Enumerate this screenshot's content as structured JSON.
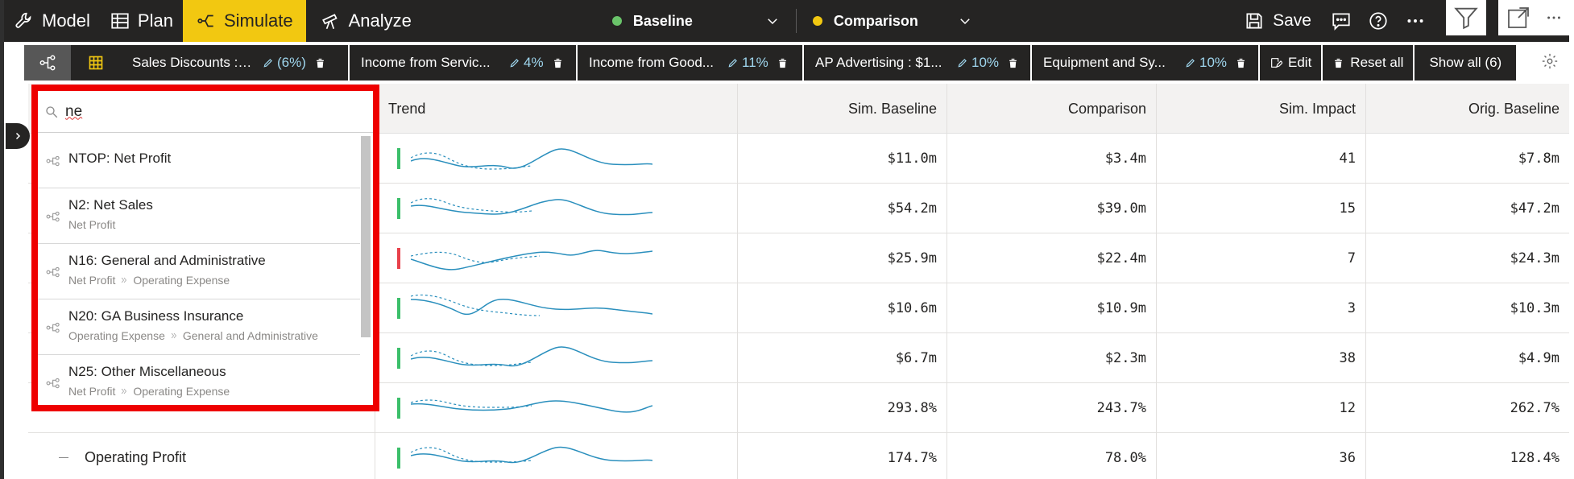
{
  "topbar": {
    "tabs": [
      {
        "label": "Model",
        "icon": "wrench-icon"
      },
      {
        "label": "Plan",
        "icon": "table-icon"
      },
      {
        "label": "Simulate",
        "icon": "simulate-icon"
      },
      {
        "label": "Analyze",
        "icon": "telescope-icon"
      }
    ],
    "baseline": {
      "label": "Baseline",
      "color": "#6ac46a"
    },
    "comparison": {
      "label": "Comparison",
      "color": "#f2c811"
    },
    "save_label": "Save"
  },
  "filterbar": {
    "chips": [
      {
        "name": "Sales Discounts : ...",
        "pct": "(6%)"
      },
      {
        "name": "Income from Servic...",
        "pct": "4%"
      },
      {
        "name": "Income from Good...",
        "pct": "11%"
      },
      {
        "name": "AP Advertising : $1...",
        "pct": "10%"
      },
      {
        "name": "Equipment and Sy...",
        "pct": "10%"
      }
    ],
    "edit_label": "Edit",
    "reset_label": "Reset all",
    "showall_label": "Show all (6)"
  },
  "table": {
    "headers": [
      "Trend",
      "Sim. Baseline",
      "Comparison",
      "Sim. Impact",
      "Orig. Baseline"
    ],
    "rows": [
      {
        "label": "",
        "sim": "$11.0m",
        "cmp": "$3.4m",
        "impact": "41",
        "orig": "$7.8m",
        "bar": "#3bbf6a"
      },
      {
        "label": "",
        "sim": "$54.2m",
        "cmp": "$39.0m",
        "impact": "15",
        "orig": "$47.2m",
        "bar": "#3bbf6a"
      },
      {
        "label": "",
        "sim": "$25.9m",
        "cmp": "$22.4m",
        "impact": "7",
        "orig": "$24.3m",
        "bar": "#e8414b"
      },
      {
        "label": "",
        "sim": "$10.6m",
        "cmp": "$10.9m",
        "impact": "3",
        "orig": "$10.3m",
        "bar": "#3bbf6a"
      },
      {
        "label": "",
        "sim": "$6.7m",
        "cmp": "$2.3m",
        "impact": "38",
        "orig": "$4.9m",
        "bar": "#3bbf6a"
      },
      {
        "label": "",
        "sim": "293.8%",
        "cmp": "243.7%",
        "impact": "12",
        "orig": "262.7%",
        "bar": "#3bbf6a"
      },
      {
        "label": "Operating Profit",
        "sim": "174.7%",
        "cmp": "78.0%",
        "impact": "36",
        "orig": "128.4%",
        "bar": "#3bbf6a"
      }
    ]
  },
  "search": {
    "value": "ne",
    "results": [
      {
        "title": "NTOP: Net Profit",
        "path": []
      },
      {
        "title": "N2: Net Sales",
        "path": [
          "Net Profit"
        ]
      },
      {
        "title": "N16: General and Administrative",
        "path": [
          "Net Profit",
          "Operating Expense"
        ]
      },
      {
        "title": "N20: GA Business Insurance",
        "path": [
          "Operating Expense",
          "General and Administrative"
        ]
      },
      {
        "title": "N25: Other Miscellaneous",
        "path": [
          "Net Profit",
          "Operating Expense"
        ]
      }
    ]
  }
}
